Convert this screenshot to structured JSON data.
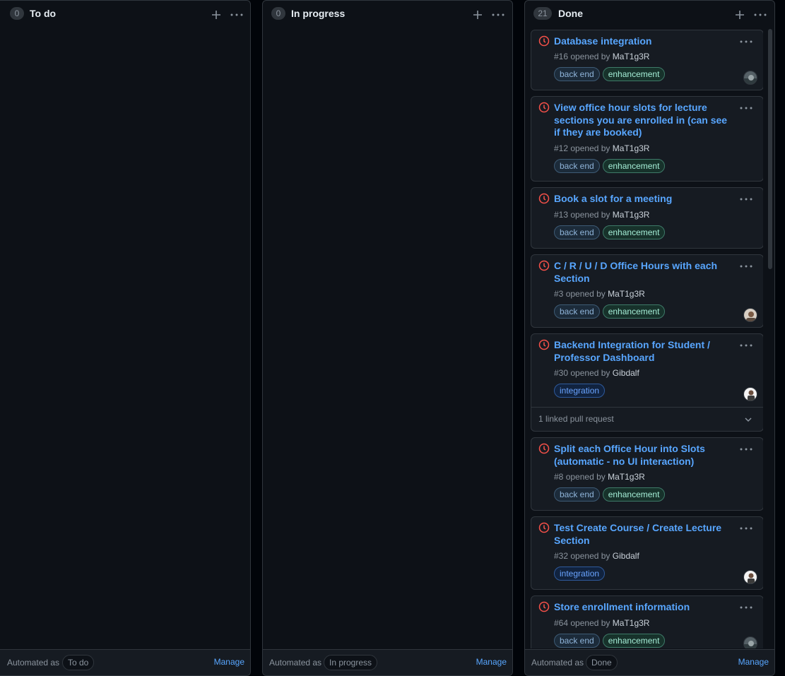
{
  "columns": [
    {
      "count": "0",
      "title": "To do",
      "automated_label": "Automated as",
      "automated_value": "To do",
      "manage": "Manage"
    },
    {
      "count": "0",
      "title": "In progress",
      "automated_label": "Automated as",
      "automated_value": "In progress",
      "manage": "Manage"
    },
    {
      "count": "21",
      "title": "Done",
      "automated_label": "Automated as",
      "automated_value": "Done",
      "manage": "Manage"
    }
  ],
  "labels": {
    "backend": "back end",
    "enhancement": "enhancement",
    "integration": "integration"
  },
  "cards": [
    {
      "title": "Database integration",
      "number": "#16",
      "opened_by": "opened by",
      "author": "MaT1g3R"
    },
    {
      "title": "View office hour slots for lecture sections you are enrolled in (can see if they are booked)",
      "number": "#12",
      "opened_by": "opened by",
      "author": "MaT1g3R"
    },
    {
      "title": "Book a slot for a meeting",
      "number": "#13",
      "opened_by": "opened by",
      "author": "MaT1g3R"
    },
    {
      "title": "C / R / U / D Office Hours with each Section",
      "number": "#3",
      "opened_by": "opened by",
      "author": "MaT1g3R"
    },
    {
      "title": "Backend Integration for Student / Professor Dashboard",
      "number": "#30",
      "opened_by": "opened by",
      "author": "Gibdalf",
      "linked": "1 linked pull request"
    },
    {
      "title": "Split each Office Hour into Slots (automatic - no UI interaction)",
      "number": "#8",
      "opened_by": "opened by",
      "author": "MaT1g3R"
    },
    {
      "title": "Test Create Course / Create Lecture Section",
      "number": "#32",
      "opened_by": "opened by",
      "author": "Gibdalf"
    },
    {
      "title": "Store enrollment information",
      "number": "#64",
      "opened_by": "opened by",
      "author": "MaT1g3R"
    }
  ],
  "colors": {
    "link": "#58a6ff",
    "issue_closed": "#f85149",
    "background": "#010409",
    "card": "#161b22"
  },
  "icons": [
    "plus-icon",
    "kebab-menu-icon",
    "issue-icon",
    "chevron-down-icon",
    "avatar"
  ]
}
